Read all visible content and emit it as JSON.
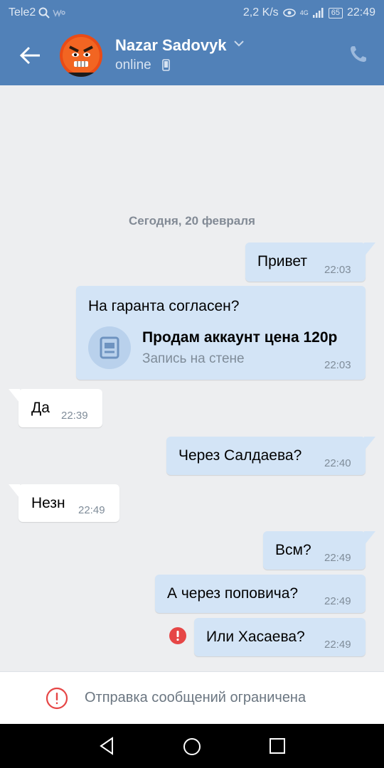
{
  "status_bar": {
    "carrier": "Tele2",
    "speed": "2,2 K/s",
    "network": "4G",
    "battery": "65",
    "time": "22:49"
  },
  "header": {
    "contact_name": "Nazar Sadovyk",
    "status": "online",
    "brand_color": "#5181b8"
  },
  "chat": {
    "date_separator": "Сегодня, 20 февраля",
    "messages": [
      {
        "dir": "out",
        "text": "Привет",
        "time": "22:03"
      },
      {
        "dir": "out",
        "text": "На гаранта согласен?",
        "time": "22:03",
        "attachment": {
          "title": "Продам аккаунт цена 120р",
          "subtitle": "Запись на стене",
          "icon": "wall-post-icon"
        }
      },
      {
        "dir": "in",
        "text": "Да",
        "time": "22:39"
      },
      {
        "dir": "out",
        "text": "Через Салдаева?",
        "time": "22:40"
      },
      {
        "dir": "in",
        "text": "Незн",
        "time": "22:49"
      },
      {
        "dir": "out",
        "text": "Всм?",
        "time": "22:49"
      },
      {
        "dir": "out",
        "text": "А через поповича?",
        "time": "22:49"
      },
      {
        "dir": "out",
        "text": "Или Хасаева?",
        "time": "22:49",
        "failed": true
      }
    ]
  },
  "footer": {
    "restriction_text": "Отправка сообщений ограничена"
  }
}
